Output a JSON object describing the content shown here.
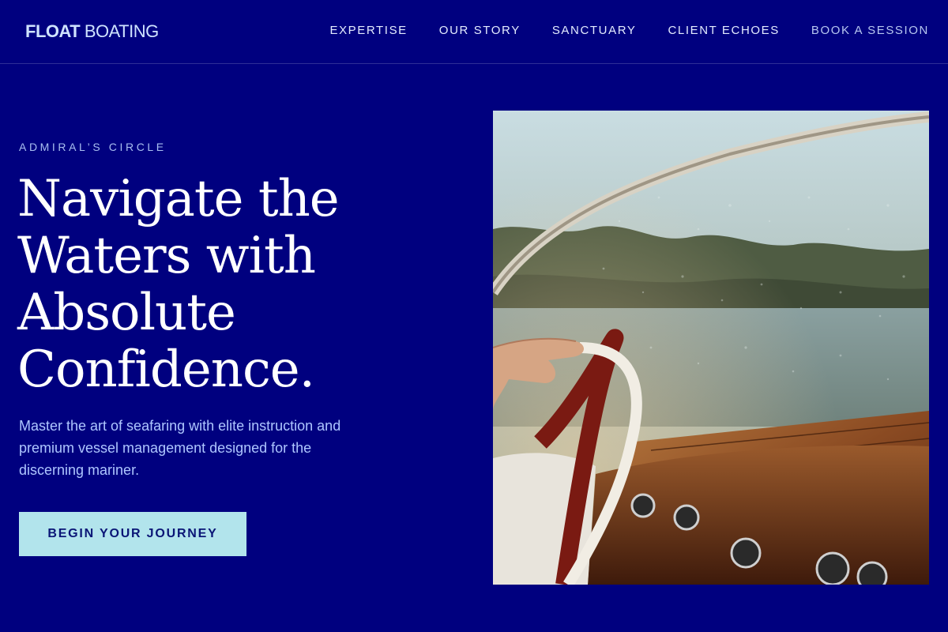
{
  "brand": {
    "name_bold": "FLOAT",
    "name_light": "BOATING"
  },
  "nav": {
    "items": [
      {
        "label": "EXPERTISE"
      },
      {
        "label": "OUR STORY"
      },
      {
        "label": "SANCTUARY"
      },
      {
        "label": "CLIENT ECHOES"
      },
      {
        "label": "BOOK A SESSION"
      }
    ]
  },
  "hero": {
    "eyebrow": "ADMIRAL’S CIRCLE",
    "headline": "Navigate the Waters with Absolute Confidence.",
    "subtext": "Master the art of seafaring with elite instruction and premium vessel management designed for the discerning mariner.",
    "cta_label": "BEGIN YOUR JOURNEY"
  },
  "colors": {
    "background": "#00007f",
    "cta_background": "#b2e4ec",
    "cta_text": "#0a1576",
    "accent_text": "#aec6ff"
  },
  "icons": {
    "hero_image": "boat-steering-wheel-photo"
  }
}
